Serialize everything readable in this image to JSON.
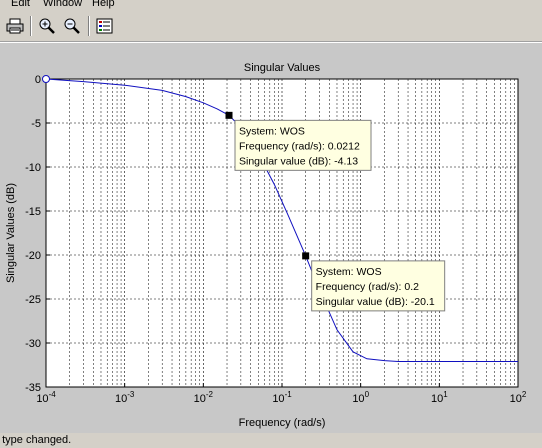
{
  "menubar": {
    "items": [
      "Edit",
      "Window",
      "Help"
    ]
  },
  "toolbar": {
    "buttons": [
      {
        "name": "print-button",
        "icon": "printer-icon"
      },
      {
        "name": "zoom-in-button",
        "icon": "zoom-in-icon"
      },
      {
        "name": "zoom-out-button",
        "icon": "zoom-out-icon"
      },
      {
        "name": "legend-button",
        "icon": "legend-icon"
      }
    ]
  },
  "colors": {
    "curve": "#1010c0",
    "background": "#d4d0c8",
    "axes_bg": "#ffffff",
    "tooltip_bg": "#ffffe1"
  },
  "chart_data": {
    "type": "line",
    "title": "Singular Values",
    "xlabel": "Frequency (rad/s)",
    "ylabel": "Singular Values (dB)",
    "xscale": "log",
    "xlim": [
      0.0001,
      100
    ],
    "ylim": [
      -35,
      0
    ],
    "xtick_exponents": [
      -4,
      -3,
      -2,
      -1,
      0,
      1,
      2
    ],
    "xtick_base": "10",
    "yticks": [
      0,
      -5,
      -10,
      -15,
      -20,
      -25,
      -30,
      -35
    ],
    "grid": true,
    "series": [
      {
        "x": [
          0.0001,
          0.0003,
          0.001,
          0.003,
          0.006,
          0.01,
          0.015,
          0.0212,
          0.03,
          0.05,
          0.08,
          0.12,
          0.2,
          0.3,
          0.5,
          0.8,
          1.2,
          2,
          3,
          5,
          10,
          30,
          100
        ],
        "y": [
          0,
          -0.3,
          -0.7,
          -1.3,
          -2.0,
          -2.7,
          -3.4,
          -4.13,
          -5.5,
          -8.5,
          -12,
          -15.5,
          -20.1,
          -24,
          -28.5,
          -31,
          -31.8,
          -32.0,
          -32.1,
          -32.1,
          -32.1,
          -32.1,
          -32.1
        ]
      }
    ],
    "annotations": [
      {
        "x": 0.0212,
        "y": -4.13,
        "lines": [
          "System: WOS",
          "Frequency (rad/s): 0.0212",
          "Singular value (dB): -4.13"
        ]
      },
      {
        "x": 0.2,
        "y": -20.1,
        "lines": [
          "System: WOS",
          "Frequency (rad/s): 0.2",
          "Singular value (dB): -20.1"
        ]
      }
    ]
  },
  "status": {
    "text": "t type changed."
  }
}
